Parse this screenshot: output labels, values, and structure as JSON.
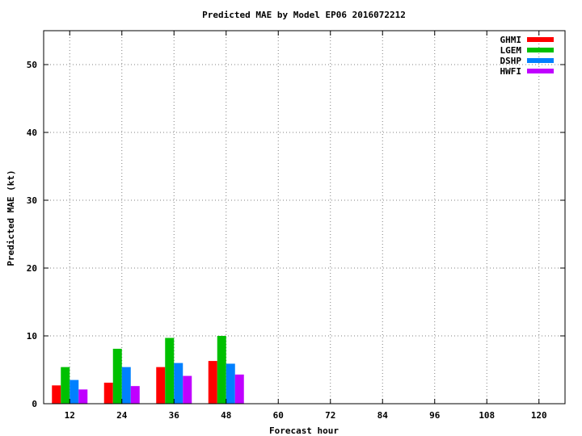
{
  "chart_data": {
    "type": "bar",
    "title": "Predicted MAE by Model  EP06 2016072212",
    "xlabel": "Forecast hour",
    "ylabel": "Predicted MAE (kt)",
    "categories": [
      "12",
      "24",
      "36",
      "48",
      "60",
      "72",
      "84",
      "96",
      "108",
      "120"
    ],
    "ylim": [
      0,
      55
    ],
    "yticks": [
      0,
      10,
      20,
      30,
      40,
      50
    ],
    "grid": true,
    "legend_position": "top-right",
    "series": [
      {
        "name": "GHMI",
        "color": "#ff0000",
        "values": [
          2.7,
          3.1,
          5.4,
          6.3,
          null,
          null,
          null,
          null,
          null,
          null
        ]
      },
      {
        "name": "LGEM",
        "color": "#00c000",
        "values": [
          5.4,
          8.1,
          9.7,
          10.0,
          null,
          null,
          null,
          null,
          null,
          null
        ]
      },
      {
        "name": "DSHP",
        "color": "#0080ff",
        "values": [
          3.5,
          5.4,
          6.0,
          5.9,
          null,
          null,
          null,
          null,
          null,
          null
        ]
      },
      {
        "name": "HWFI",
        "color": "#c000ff",
        "values": [
          2.1,
          2.6,
          4.1,
          4.3,
          null,
          null,
          null,
          null,
          null,
          null
        ]
      }
    ]
  }
}
